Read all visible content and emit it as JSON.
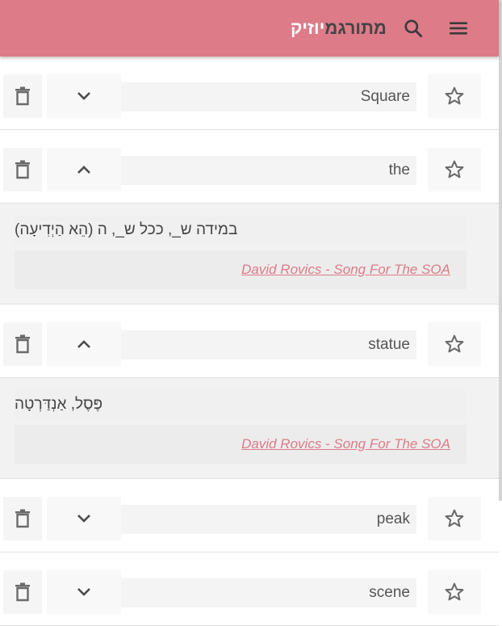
{
  "app": {
    "title_part1": "מתורגמ",
    "title_part2": "יוזיק"
  },
  "colors": {
    "primary": "#dd7b89",
    "text": "#555555"
  },
  "icons": {
    "menu": "menu-icon",
    "search": "search-icon",
    "delete": "trash-icon",
    "expand": "chevron-down-icon",
    "collapse": "chevron-up-icon",
    "favorite": "star-outline-icon"
  },
  "entries": [
    {
      "word": "Square",
      "expanded": false
    },
    {
      "word": "the",
      "expanded": true,
      "translation": "במידה ש_, ככל ש_, ה (הֵא הַיְדִיעָה)",
      "source": "David Rovics - Song For The SOA"
    },
    {
      "word": "statue",
      "expanded": true,
      "translation": "פֶּסֶל, אַנְדַּרְטָה",
      "source": "David Rovics - Song For The SOA"
    },
    {
      "word": "peak",
      "expanded": false
    },
    {
      "word": "scene",
      "expanded": false
    }
  ]
}
